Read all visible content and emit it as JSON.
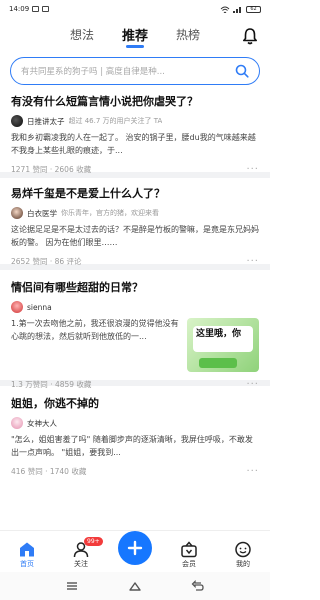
{
  "status_bar": {
    "time": "14:09",
    "battery": "62"
  },
  "tabs": [
    {
      "label": "想法",
      "active": false
    },
    {
      "label": "推荐",
      "active": true
    },
    {
      "label": "热榜",
      "active": false
    }
  ],
  "search": {
    "placeholder": "有共同星系的狗子吗 | 高度自律是种..."
  },
  "feed": [
    {
      "title": "有没有什么短篇言情小说把你虐哭了？",
      "author": "日推讲太子",
      "author_desc": "超过 46.7 万的用户关注了 TA",
      "excerpt": "我和乡初霸凌我的人在一起了。 治安的锅子里，腰du我的气味越来越不我身上某些扎眼的痕迹，于...",
      "stats": "1271 赞同 · 2606 收藏"
    },
    {
      "title": "易烊千玺是不是爱上什么人了？",
      "author": "白衣医学",
      "author_desc": "你乐青年，官方的猪，欢迎来看",
      "excerpt": "这论据足足是不是太过去的话？不是醉是竹板的警嘛，是竟是东兄妈妈板的警。 因为在他们眼里……",
      "stats": "2652 赞同 · 86 评论"
    },
    {
      "title": "情侣间有哪些超甜的日常？",
      "author": "sienna",
      "author_desc": "",
      "excerpt": "1.第一次去吻他之前，我还很浪漫的觉得他没有心跳的想法，然后就听到他放低的一...",
      "thumb_text": "这里哦，你",
      "stats": "1.3 万赞同 · 4859 收藏"
    },
    {
      "title": "姐姐，你逃不掉的",
      "author": "女神大人",
      "author_desc": "",
      "excerpt": "\"怎么，姐姐害羞了吗\" 随着脚步声的逐渐清晰，我屏住呼吸，不敢发出一点声响。 \"姐姐，要我到...",
      "stats": "416 赞同 · 1740 收藏"
    }
  ],
  "bottom_nav": [
    {
      "label": "首页",
      "active": true
    },
    {
      "label": "关注",
      "badge": "99+"
    },
    {
      "label": ""
    },
    {
      "label": "会员"
    },
    {
      "label": "我的"
    }
  ],
  "colors": {
    "accent": "#2f7cf6",
    "fab": "#1677ff",
    "badge": "#f23b3b"
  }
}
